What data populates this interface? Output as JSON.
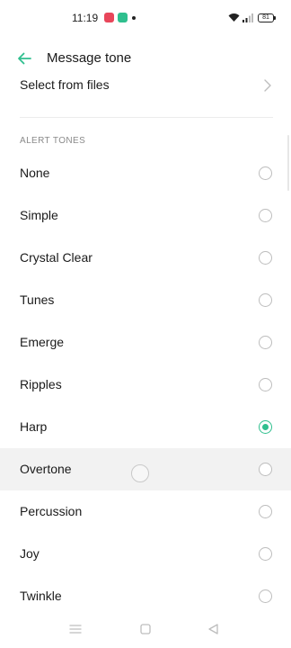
{
  "status_bar": {
    "time": "11:19",
    "battery_level": "81",
    "notification_icons": [
      "red-app-icon",
      "green-app-icon"
    ],
    "system_icons": [
      "wifi-icon",
      "signal-icon",
      "battery-icon"
    ]
  },
  "header": {
    "title": "Message tone",
    "back_icon": "arrow-left-icon",
    "accent_color": "#2fbf8e"
  },
  "select_from_files": {
    "label": "Select from files",
    "icon": "chevron-right-icon"
  },
  "section": {
    "header": "ALERT TONES"
  },
  "tones": [
    {
      "label": "None",
      "selected": false
    },
    {
      "label": "Simple",
      "selected": false
    },
    {
      "label": "Crystal Clear",
      "selected": false
    },
    {
      "label": "Tunes",
      "selected": false
    },
    {
      "label": "Emerge",
      "selected": false
    },
    {
      "label": "Ripples",
      "selected": false
    },
    {
      "label": "Harp",
      "selected": true
    },
    {
      "label": "Overtone",
      "selected": false,
      "pressed": true
    },
    {
      "label": "Percussion",
      "selected": false
    },
    {
      "label": "Joy",
      "selected": false
    },
    {
      "label": "Twinkle",
      "selected": false
    }
  ],
  "nav_bar": {
    "icons": [
      "menu-icon",
      "home-icon",
      "back-triangle-icon"
    ]
  }
}
